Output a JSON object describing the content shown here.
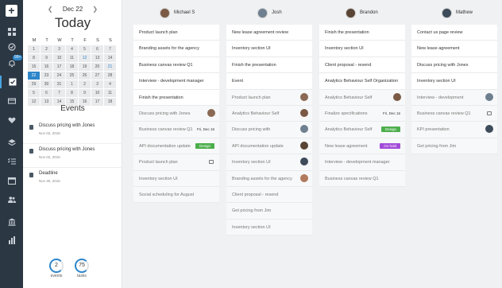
{
  "calendar": {
    "month_label": "Dec 22",
    "prev_icon": "chevron-left-icon",
    "next_icon": "chevron-right-icon",
    "title": "Today",
    "weekdays": [
      "M",
      "T",
      "W",
      "T",
      "F",
      "S",
      "S"
    ],
    "weeks": [
      [
        "1",
        "2",
        "3",
        "4",
        "5",
        "6",
        "7"
      ],
      [
        "8",
        "9",
        "10",
        "11",
        "12",
        "13",
        "14"
      ],
      [
        "15",
        "16",
        "17",
        "18",
        "19",
        "20",
        "21"
      ],
      [
        "22",
        "23",
        "24",
        "25",
        "26",
        "27",
        "28"
      ],
      [
        "29",
        "30",
        "31",
        "1",
        "2",
        "3",
        "4"
      ],
      [
        "5",
        "6",
        "7",
        "8",
        "9",
        "10",
        "11"
      ],
      [
        "12",
        "13",
        "14",
        "15",
        "16",
        "17",
        "18"
      ]
    ],
    "selected_day": "22"
  },
  "events": {
    "title": "Events",
    "items": [
      {
        "title": "Discuss pricing with Jones",
        "date": "Nov 02, 2016"
      },
      {
        "title": "Discuss pricing with Jones",
        "date": "Nov 02, 2016"
      },
      {
        "title": "Deadline",
        "date": "Nov 30, 2016"
      }
    ]
  },
  "stats": [
    {
      "value": "2",
      "label": "events"
    },
    {
      "value": "75",
      "label": "tasks"
    }
  ],
  "rail": {
    "badge": "99+",
    "accent": "#2e86c9"
  },
  "columns": [
    {
      "name": "Michael S",
      "cards": [
        {
          "text": "Product launch plan",
          "done": false
        },
        {
          "text": "Branding assets for the agency",
          "done": false
        },
        {
          "text": "Business canvas review Q1",
          "done": false
        },
        {
          "text": "Interview - development manager",
          "done": false
        },
        {
          "text": "Finish the presentation",
          "done": false
        },
        {
          "text": "Discuss pricing with Jones",
          "done": true,
          "avatar": true
        },
        {
          "text": "Business canvas review Q1",
          "done": true,
          "date": "Fri, Dec 16"
        },
        {
          "text": "API documentation update",
          "done": true,
          "tag": "Design",
          "tag_color": "#4cae4c"
        },
        {
          "text": "Product launch plan",
          "done": true,
          "comment": true
        },
        {
          "text": "Inventory section UI",
          "done": true
        },
        {
          "text": "Social scheduling for August",
          "done": true
        }
      ]
    },
    {
      "name": "Josh",
      "cards": [
        {
          "text": "New lease agreement review",
          "done": false
        },
        {
          "text": "Inventory section UI",
          "done": false
        },
        {
          "text": "Finish the presentation",
          "done": false
        },
        {
          "text": "Event",
          "done": false
        },
        {
          "text": "Product launch plan",
          "done": true,
          "avatar": true
        },
        {
          "text": "Analytics Behaviour Self",
          "done": true,
          "avatar": true
        },
        {
          "text": "Discuss pricing with",
          "done": true,
          "avatar": true
        },
        {
          "text": "API documentation update",
          "done": true,
          "avatar": true
        },
        {
          "text": "Inventory section UI",
          "done": true,
          "avatar": true
        },
        {
          "text": "Branding assets for the agency",
          "done": true,
          "avatar": true
        },
        {
          "text": "Client proposal - resend",
          "done": true
        },
        {
          "text": "Get pricing from Jim",
          "done": true
        },
        {
          "text": "Inventory section UI",
          "done": true
        }
      ]
    },
    {
      "name": "Brandon",
      "cards": [
        {
          "text": "Finish the presentation",
          "done": false
        },
        {
          "text": "Inventory section UI",
          "done": false
        },
        {
          "text": "Client proposal - resend",
          "done": false
        },
        {
          "text": "Analytics Behaviour Self Organization",
          "done": false
        },
        {
          "text": "Analytics Behaviour Self",
          "done": true,
          "avatar": true
        },
        {
          "text": "Finalize specifications",
          "done": true,
          "date": "Fri, Dec 16"
        },
        {
          "text": "Analytics Behaviour Self",
          "done": true,
          "tag": "Design",
          "tag_color": "#4cae4c"
        },
        {
          "text": "New lease agreement",
          "done": true,
          "tag": "On hold",
          "tag_color": "#a24bd9"
        },
        {
          "text": "Interview - development manager",
          "done": true
        },
        {
          "text": "Business canvas review Q1",
          "done": true
        }
      ]
    },
    {
      "name": "Mathew",
      "cards": [
        {
          "text": "Contact us page review",
          "done": false
        },
        {
          "text": "New lease agreement",
          "done": false
        },
        {
          "text": "Discuss pricing with Jones",
          "done": false
        },
        {
          "text": "Inventory section UI",
          "done": false
        },
        {
          "text": "Interview - development",
          "done": true,
          "avatar": true
        },
        {
          "text": "Business canvas review Q1",
          "done": true,
          "comment": true
        },
        {
          "text": "KPI presentation",
          "done": true,
          "avatar": true
        },
        {
          "text": "Get pricing from Jim",
          "done": true
        }
      ]
    }
  ]
}
